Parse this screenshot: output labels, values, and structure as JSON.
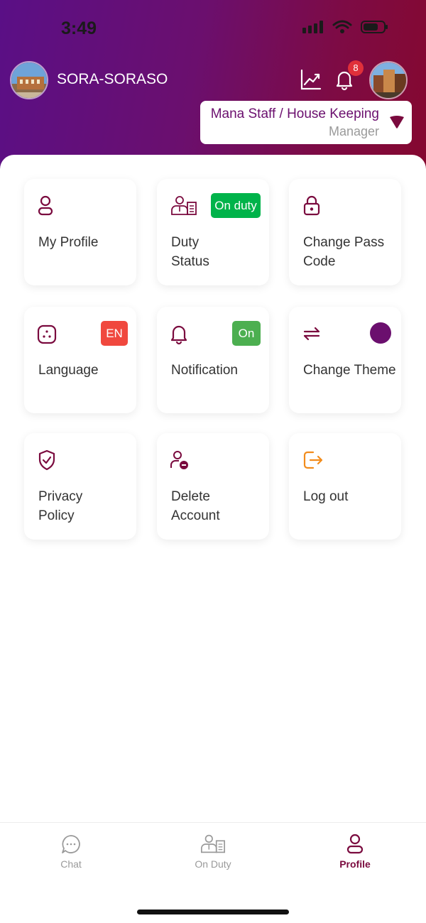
{
  "status": {
    "time": "3:49"
  },
  "header": {
    "hotel_name": "SORA-SORASO",
    "notification_count": "8",
    "department": "Mana Staff / House Keeping",
    "role": "Manager"
  },
  "colors": {
    "accent": "#7a0a3e",
    "brand_purple": "#6b0f6e",
    "on_green": "#00b34a",
    "notification_green": "#4caf50",
    "language_red": "#f0483e",
    "logout_orange": "#f28c1c",
    "theme_color": "#6b0f6e"
  },
  "cards": {
    "my_profile": {
      "label": "My Profile",
      "icon": "person-icon"
    },
    "duty_status": {
      "label": "Duty\nStatus",
      "badge": "On duty",
      "icon": "duty-staff-icon"
    },
    "change_pass_code": {
      "label": "Change Pass\nCode",
      "icon": "lock-icon"
    },
    "language": {
      "label": "Language",
      "badge": "EN",
      "icon": "language-icon"
    },
    "notification": {
      "label": "Notification",
      "badge": "On",
      "icon": "bell-icon"
    },
    "change_theme": {
      "label": "Change Theme",
      "icon": "swap-arrows-icon"
    },
    "privacy_policy": {
      "label": "Privacy\nPolicy",
      "icon": "shield-check-icon"
    },
    "delete_account": {
      "label": "Delete\nAccount",
      "icon": "person-remove-icon"
    },
    "log_out": {
      "label": "Log out",
      "icon": "logout-icon"
    }
  },
  "tabs": [
    {
      "label": "Chat",
      "icon": "chat-bubble-icon",
      "active": false
    },
    {
      "label": "On Duty",
      "icon": "duty-staff-icon",
      "active": false
    },
    {
      "label": "Profile",
      "icon": "person-icon",
      "active": true
    }
  ]
}
